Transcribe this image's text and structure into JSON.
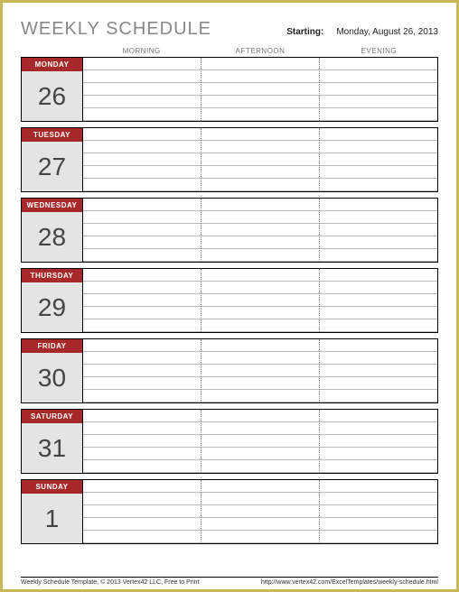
{
  "header": {
    "title": "WEEKLY SCHEDULE",
    "starting_label": "Starting:",
    "starting_date": "Monday, August 26, 2013"
  },
  "columns": [
    "MORNING",
    "AFTERNOON",
    "EVENING"
  ],
  "days": [
    {
      "label": "MONDAY",
      "num": "26"
    },
    {
      "label": "TUESDAY",
      "num": "27"
    },
    {
      "label": "WEDNESDAY",
      "num": "28"
    },
    {
      "label": "THURSDAY",
      "num": "29"
    },
    {
      "label": "FRIDAY",
      "num": "30"
    },
    {
      "label": "SATURDAY",
      "num": "31"
    },
    {
      "label": "SUNDAY",
      "num": "1"
    }
  ],
  "footer": {
    "left": "Weekly Schedule Template, © 2013 Vertex42 LLC, Free to Print",
    "right": "http://www.vertex42.com/ExcelTemplates/weekly-schedule.html"
  }
}
